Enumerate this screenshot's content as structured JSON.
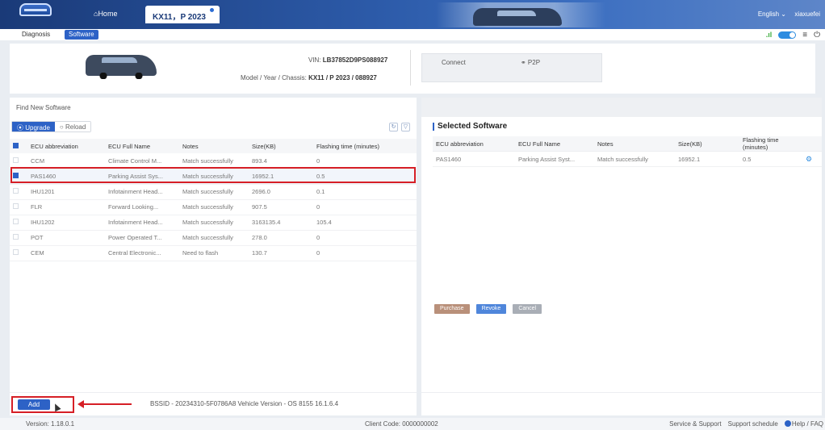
{
  "header": {
    "home_tab": "Home",
    "project_tab": "KX11，P 2023",
    "language": "English ⌄",
    "user": "xiaxuefei"
  },
  "subtabs": {
    "diagnosis": "Diagnosis",
    "software": "Software"
  },
  "status": {
    "signal": ".ıl",
    "menu": "≡",
    "power": "⏻"
  },
  "vehicle": {
    "vin_label": "VIN:",
    "vin": "LB37852D9PS088927",
    "model_label": "Model / Year / Chassis:",
    "model": "KX11 / P 2023 / 088927",
    "connect_label": "Connect",
    "connect_value": "⚭ P2P"
  },
  "find": {
    "title": "Find New Software",
    "upgrade": "⦿ Upgrade",
    "reload": "○ Reload",
    "columns": [
      "ECU abbreviation",
      "ECU Full Name",
      "Notes",
      "Size(KB)",
      "Flashing time (minutes)"
    ],
    "rows": [
      {
        "abbr": "CCM",
        "full": "Climate Control M...",
        "notes": "Match successfully",
        "size": "893.4",
        "time": "0",
        "checked": false
      },
      {
        "abbr": "PAS1460",
        "full": "Parking Assist Sys...",
        "notes": "Match successfully",
        "size": "16952.1",
        "time": "0.5",
        "checked": true
      },
      {
        "abbr": "IHU1201",
        "full": "Infotainment Head...",
        "notes": "Match successfully",
        "size": "2696.0",
        "time": "0.1",
        "checked": false
      },
      {
        "abbr": "FLR",
        "full": "Forward Looking...",
        "notes": "Match successfully",
        "size": "907.5",
        "time": "0",
        "checked": false
      },
      {
        "abbr": "IHU1202",
        "full": "Infotainment Head...",
        "notes": "Match successfully",
        "size": "3163135.4",
        "time": "105.4",
        "checked": false
      },
      {
        "abbr": "POT",
        "full": "Power Operated T...",
        "notes": "Match successfully",
        "size": "278.0",
        "time": "0",
        "checked": false
      },
      {
        "abbr": "CEM",
        "full": "Central Electronic...",
        "notes": "Need to flash",
        "size": "130.7",
        "time": "0",
        "checked": false
      }
    ],
    "add": "Add",
    "bssid": "BSSID - 20234310-5F0786A8 Vehicle Version - OS 8155 16.1.6.4"
  },
  "selected": {
    "title": "Selected Software",
    "columns": [
      "ECU abbreviation",
      "ECU Full Name",
      "Notes",
      "Size(KB)",
      "Flashing time (minutes)"
    ],
    "rows": [
      {
        "abbr": "PAS1460",
        "full": "Parking Assist Syst...",
        "notes": "Match successfully",
        "size": "16952.1",
        "time": "0.5"
      }
    ],
    "purchase": "Purchase",
    "revoke": "Revoke",
    "cancel": "Cancel"
  },
  "footer": {
    "version": "Version: 1.18.0.1",
    "client": "Client Code: 0000000002",
    "service": "Service & Support",
    "schedule": "Support schedule",
    "help": "Help / FAQ"
  },
  "colors": {
    "accent": "#2d62c6",
    "highlight": "#d61f26",
    "header": "#1a3a78"
  }
}
